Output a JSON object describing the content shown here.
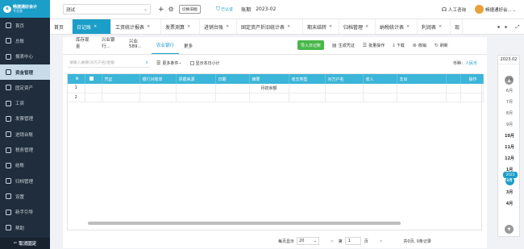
{
  "app": {
    "logo_name": "畅捷通好会计",
    "logo_sub": "专业版"
  },
  "sidebar": {
    "items": [
      {
        "label": "首页"
      },
      {
        "label": "总账"
      },
      {
        "label": "报表中心"
      },
      {
        "label": "资金管理"
      },
      {
        "label": "固定资产"
      },
      {
        "label": "工资"
      },
      {
        "label": "发票管理"
      },
      {
        "label": "进销台账"
      },
      {
        "label": "税务管理"
      },
      {
        "label": "结账"
      },
      {
        "label": "归档管理"
      },
      {
        "label": "设置"
      },
      {
        "label": "新手引导"
      },
      {
        "label": "帮助"
      }
    ],
    "active_index": 3,
    "collapse_label": "取消固定"
  },
  "header": {
    "account": "测试",
    "switch_label": "切换旧版",
    "cert_label": "已认证",
    "period_label": "账期",
    "period_value": "2023-02",
    "help_label": "人工咨询",
    "user_label": "畅捷通好会..."
  },
  "tabs": [
    {
      "label": "首页",
      "closable": false
    },
    {
      "label": "日记账",
      "closable": true,
      "active": true
    },
    {
      "label": "工资统计报表",
      "closable": true
    },
    {
      "label": "发票测算",
      "closable": true
    },
    {
      "label": "进销台账",
      "closable": true
    },
    {
      "label": "固定资产折旧统计表",
      "closable": true
    },
    {
      "label": "期末结转",
      "closable": true
    },
    {
      "label": "归档管理",
      "closable": true
    },
    {
      "label": "纳税统计表",
      "closable": true
    },
    {
      "label": "利润表",
      "closable": true
    },
    {
      "label": "现",
      "closable": false
    }
  ],
  "subtabs": {
    "items": [
      "库存现金",
      "兴业银行...",
      "兴业589...",
      "农业银行",
      "更多"
    ],
    "active_index": 3
  },
  "toolbar": {
    "import_label": "导入日记账",
    "gen_voucher": "生成凭证",
    "batch_ops": "批量操作",
    "download": "下载",
    "check": "核销",
    "refresh": "刷新"
  },
  "filter": {
    "search_placeholder": "请输入摘要/对方户名/金额",
    "more_conditions": "更多条件",
    "show_today": "显示本日小计",
    "currency_label": "币种：",
    "currency_value": "人民币"
  },
  "table": {
    "columns": [
      "凭证",
      "银行对账单",
      "票据来源",
      "日期",
      "摘要",
      "收支类型",
      "对方户名",
      "收入",
      "支出",
      "操作"
    ],
    "rows": [
      {
        "no": "1",
        "summary": "月初余额"
      },
      {
        "no": "2",
        "summary": ""
      }
    ]
  },
  "pagination": {
    "per_page_label": "每页显示",
    "per_page": "20",
    "page_label": "第",
    "page": "1",
    "page_suffix": "页",
    "info": "共0页, 0条记录"
  },
  "timeline": {
    "top_current": "2023.02",
    "items": [
      "5月",
      "6月",
      "7月",
      "8月",
      "9月",
      "10月",
      "11月",
      "12月",
      "1月",
      "2月",
      "3月",
      "4月"
    ],
    "bold_from_index": 5,
    "selected_index": 9,
    "year_badge": "2023"
  }
}
